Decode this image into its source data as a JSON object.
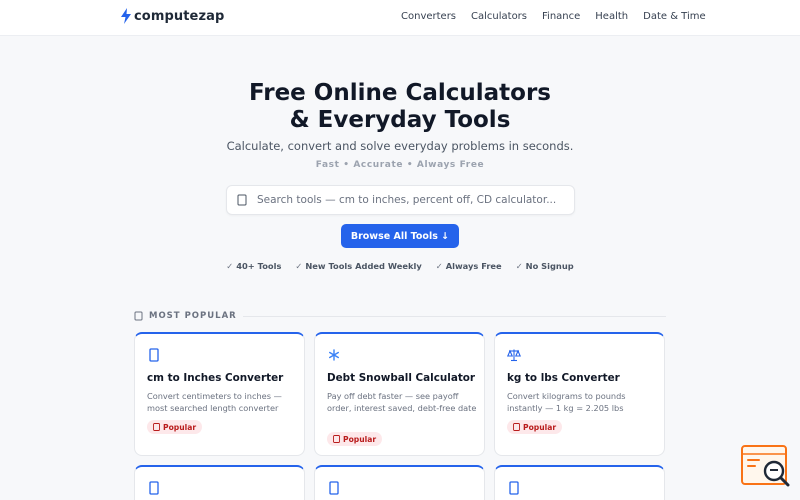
{
  "header": {
    "logo_text": "computezap",
    "nav": [
      "Converters",
      "Calculators",
      "Finance",
      "Health",
      "Date & Time"
    ]
  },
  "hero": {
    "title_line1": "Free Online Calculators",
    "title_line2": "& Everyday Tools",
    "subtitle": "Calculate, convert and solve everyday problems in seconds.",
    "tagline": "Fast • Accurate • Always Free"
  },
  "search": {
    "placeholder": "Search tools — cm to inches, percent off, CD calculator..."
  },
  "browse_button": "Browse All Tools ↓",
  "badges": [
    "40+ Tools",
    "New Tools Added Weekly",
    "Always Free",
    "No Signup"
  ],
  "badge_check": "✓",
  "section": {
    "label": "MOST POPULAR"
  },
  "cards": [
    {
      "icon": "ruler-icon",
      "title": "cm to Inches Converter",
      "desc": "Convert centimeters to inches — most searched length converter",
      "badge": "Popular"
    },
    {
      "icon": "snowflake-icon",
      "title": "Debt Snowball Calculator",
      "desc": "Pay off debt faster — see payoff order, interest saved, debt-free date",
      "badge": "Popular"
    },
    {
      "icon": "scale-icon",
      "title": "kg to lbs Converter",
      "desc": "Convert kilograms to pounds instantly — 1 kg = 2.205 lbs",
      "badge": "Popular"
    }
  ],
  "colors": {
    "accent": "#2563eb",
    "badge_bg": "#fde8ea",
    "badge_text": "#b91c1c",
    "fab": "#f97316"
  }
}
